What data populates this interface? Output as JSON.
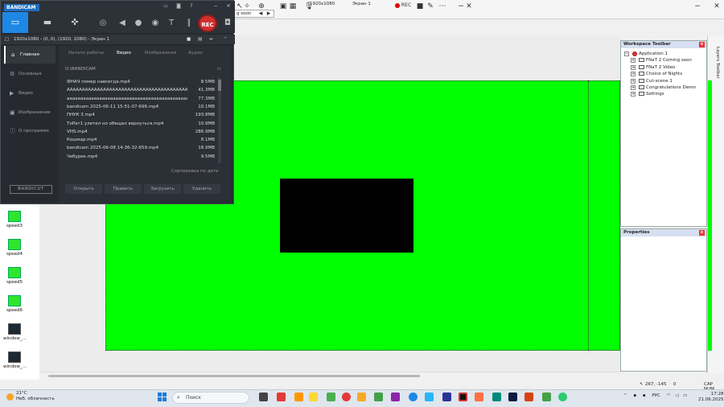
{
  "editor": {
    "resolution_field": "1920x1080",
    "screen_field": "Экран 1",
    "rec_label": "REC",
    "dropdown_value": "g soon",
    "workspace_toolbar_title": "Workspace Toolbar",
    "properties_title": "Properties",
    "layers_toolbar_label": "Layers Toolbar",
    "tree": {
      "root": "Application 1",
      "children": [
        "FNaT 2 Coming soon",
        "FNaT  2 Video",
        "Choice of Nights",
        "Cut-scene 1",
        "Congratulations Demo",
        "Settings"
      ]
    },
    "status": {
      "coords": "267, -145",
      "zero": "0",
      "caps": "CAP NUM"
    }
  },
  "desktop_icons": [
    {
      "label": "speed3"
    },
    {
      "label": "speed4"
    },
    {
      "label": "speed5"
    },
    {
      "label": "speed6"
    },
    {
      "label": "window_..."
    },
    {
      "label": "window_..."
    }
  ],
  "bandicam": {
    "logo": "BANDICAM",
    "rec_label": "REC",
    "info_bar": "1920x1080 - (0, 0), (1920, 1080) - Экран 1",
    "nav": [
      "Главная",
      "Основные",
      "Видео",
      "Изображения",
      "О программе"
    ],
    "tabs": [
      "Начало работы",
      "Видео",
      "Изображения",
      "Аудио"
    ],
    "active_tab": "Видео",
    "path": "D:\\BANDICAM",
    "files": [
      {
        "name": "ФНАЧ помер навсегда.mp4",
        "size": "8.5MB"
      },
      {
        "name": "АААААААААААААААААААААААААААААААААААААААААААА...",
        "size": "41.3MB"
      },
      {
        "name": "аааааааааааааааааааааааааааааааааааааааааааааааа...",
        "size": "77.3MB"
      },
      {
        "name": "bandicam 2025-06-11 15-51-07-696.mp4",
        "size": "10.1MB"
      },
      {
        "name": "ПНУК 3.mp4",
        "size": "193.8MB"
      },
      {
        "name": "ТоРат1 улетел но обещал вернуться.mp4",
        "size": "10.9MB"
      },
      {
        "name": "VHS.mp4",
        "size": "286.9MB"
      },
      {
        "name": "Кошмар.mp4",
        "size": "8.1MB"
      },
      {
        "name": "bandicam 2025-06-08 14-36-32-659.mp4",
        "size": "18.9MB"
      },
      {
        "name": "Чебурек.mp4",
        "size": "9.5MB"
      }
    ],
    "sort_label": "Сортировка по дате",
    "buttons": [
      "Открыть",
      "Править",
      "Загрузить",
      "Удалить"
    ],
    "bandicut": "BANDICUT"
  },
  "taskbar": {
    "temp": "21°C",
    "weather": "Неб. облачность",
    "search_placeholder": "Поиск",
    "lang": "РУС",
    "time": "17:28",
    "date": "21.06.2025"
  },
  "colors": {
    "canvas_green": "#00ff00",
    "bandicam_blue": "#1e88e5",
    "rec_red": "#d32f2f"
  }
}
